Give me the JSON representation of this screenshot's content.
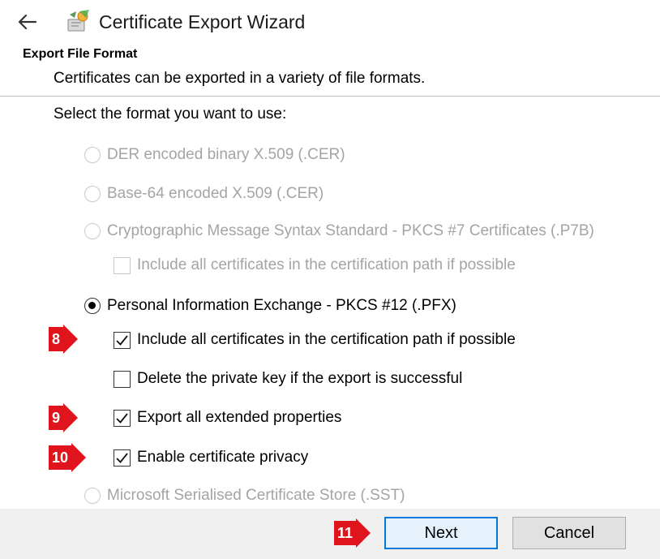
{
  "window": {
    "title": "Certificate Export Wizard",
    "back_icon": "back-arrow-icon",
    "app_icon": "certificate-wizard-icon"
  },
  "header": {
    "title": "Export File Format",
    "subtitle": "Certificates can be exported in a variety of file formats."
  },
  "prompt": "Select the format you want to use:",
  "options": {
    "der": {
      "label": "DER encoded binary X.509 (.CER)",
      "selected": false,
      "enabled": false
    },
    "base64": {
      "label": "Base-64 encoded X.509 (.CER)",
      "selected": false,
      "enabled": false
    },
    "pkcs7": {
      "label": "Cryptographic Message Syntax Standard - PKCS #7 Certificates (.P7B)",
      "selected": false,
      "enabled": false
    },
    "pkcs7_include": {
      "label": "Include all certificates in the certification path if possible",
      "checked": false,
      "enabled": false
    },
    "pfx": {
      "label": "Personal Information Exchange - PKCS #12 (.PFX)",
      "selected": true,
      "enabled": true
    },
    "pfx_include": {
      "label": "Include all certificates in the certification path if possible",
      "checked": true,
      "enabled": true
    },
    "pfx_delete_key": {
      "label": "Delete the private key if the export is successful",
      "checked": false,
      "enabled": true
    },
    "pfx_export_props": {
      "label": "Export all extended properties",
      "checked": true,
      "enabled": true
    },
    "pfx_privacy": {
      "label": "Enable certificate privacy",
      "checked": true,
      "enabled": true
    },
    "sst": {
      "label": "Microsoft Serialised Certificate Store (.SST)",
      "selected": false,
      "enabled": false
    }
  },
  "markers": {
    "m8": "8",
    "m9": "9",
    "m10": "10",
    "m11": "11"
  },
  "buttons": {
    "next": "Next",
    "cancel": "Cancel"
  },
  "colors": {
    "marker": "#e0141c",
    "disabled_text": "#a4a4a4",
    "default_button_border": "#0078d7",
    "footer": "#f0f0f0"
  }
}
